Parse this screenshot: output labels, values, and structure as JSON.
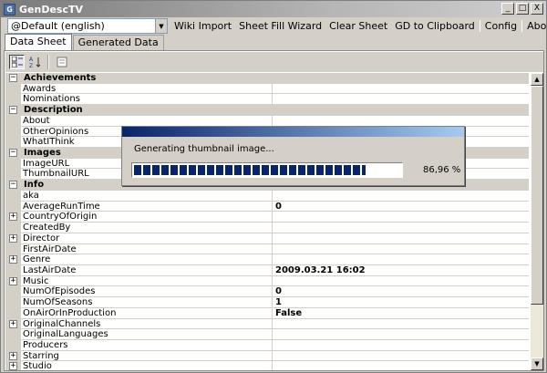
{
  "window": {
    "title": "GenDescTV",
    "icon": "app-icon",
    "controls": [
      "_",
      "□",
      "X"
    ]
  },
  "toolbar": {
    "profile_select": "@Default (english)",
    "menu": [
      "Wiki Import",
      "Sheet Fill Wizard",
      "Clear Sheet",
      "GD to Clipboard",
      "Config",
      "About"
    ]
  },
  "tabs": [
    {
      "label": "Data Sheet",
      "active": true
    },
    {
      "label": "Generated Data",
      "active": false
    }
  ],
  "grid_toolbar": {
    "buttons": [
      "categorized-view-icon",
      "alphabetical-sort-icon",
      "property-pages-icon"
    ]
  },
  "rows": [
    {
      "type": "category",
      "name": "Achievements"
    },
    {
      "type": "prop",
      "name": "Awards",
      "value": ""
    },
    {
      "type": "prop",
      "name": "Nominations",
      "value": ""
    },
    {
      "type": "category",
      "name": "Description"
    },
    {
      "type": "prop",
      "name": "About",
      "value": ""
    },
    {
      "type": "prop",
      "name": "OtherOpinions",
      "value": ""
    },
    {
      "type": "prop",
      "name": "WhatIThink",
      "value": ""
    },
    {
      "type": "category",
      "name": "Images"
    },
    {
      "type": "prop",
      "name": "ImageURL",
      "value": ""
    },
    {
      "type": "prop",
      "name": "ThumbnailURL",
      "value": ""
    },
    {
      "type": "category",
      "name": "Info"
    },
    {
      "type": "prop",
      "name": "aka",
      "value": ""
    },
    {
      "type": "prop",
      "name": "AverageRunTime",
      "value": "0"
    },
    {
      "type": "prop",
      "name": "CountryOfOrigin",
      "value": "",
      "expandable": true
    },
    {
      "type": "prop",
      "name": "CreatedBy",
      "value": ""
    },
    {
      "type": "prop",
      "name": "Director",
      "value": "",
      "expandable": true
    },
    {
      "type": "prop",
      "name": "FirstAirDate",
      "value": ""
    },
    {
      "type": "prop",
      "name": "Genre",
      "value": "",
      "expandable": true
    },
    {
      "type": "prop",
      "name": "LastAirDate",
      "value": "2009.03.21 16:02"
    },
    {
      "type": "prop",
      "name": "Music",
      "value": "",
      "expandable": true
    },
    {
      "type": "prop",
      "name": "NumOfEpisodes",
      "value": "0"
    },
    {
      "type": "prop",
      "name": "NumOfSeasons",
      "value": "1"
    },
    {
      "type": "prop",
      "name": "OnAirOrInProduction",
      "value": "False"
    },
    {
      "type": "prop",
      "name": "OriginalChannels",
      "value": "",
      "expandable": true
    },
    {
      "type": "prop",
      "name": "OriginalLanguages",
      "value": ""
    },
    {
      "type": "prop",
      "name": "Producers",
      "value": ""
    },
    {
      "type": "prop",
      "name": "Starring",
      "value": "",
      "expandable": true
    },
    {
      "type": "prop",
      "name": "Studio",
      "value": "",
      "expandable": true
    }
  ],
  "progress_dialog": {
    "message": "Generating thumbnail image...",
    "percent_text": "86,96 %",
    "fraction": 0.8696
  }
}
